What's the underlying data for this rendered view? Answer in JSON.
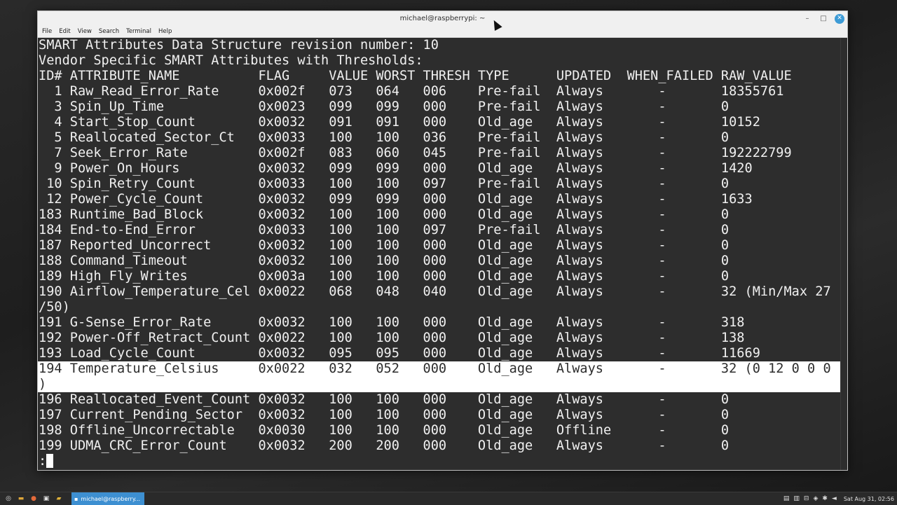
{
  "window": {
    "title": "michael@raspberrypi: ~",
    "controls": {
      "minimize": "–",
      "maximize": "□",
      "close": "✕"
    }
  },
  "menu": [
    "File",
    "Edit",
    "View",
    "Search",
    "Terminal",
    "Help"
  ],
  "terminal": {
    "lines": [
      "SMART Attributes Data Structure revision number: 10",
      "Vendor Specific SMART Attributes with Thresholds:",
      "ID# ATTRIBUTE_NAME          FLAG     VALUE WORST THRESH TYPE      UPDATED  WHEN_FAILED RAW_VALUE",
      "  1 Raw_Read_Error_Rate     0x002f   073   064   006    Pre-fail  Always       -       18355761",
      "  3 Spin_Up_Time            0x0023   099   099   000    Pre-fail  Always       -       0",
      "  4 Start_Stop_Count        0x0032   091   091   000    Old_age   Always       -       10152",
      "  5 Reallocated_Sector_Ct   0x0033   100   100   036    Pre-fail  Always       -       0",
      "  7 Seek_Error_Rate         0x002f   083   060   045    Pre-fail  Always       -       192222799",
      "  9 Power_On_Hours          0x0032   099   099   000    Old_age   Always       -       1420",
      " 10 Spin_Retry_Count        0x0033   100   100   097    Pre-fail  Always       -       0",
      " 12 Power_Cycle_Count       0x0032   099   099   000    Old_age   Always       -       1633",
      "183 Runtime_Bad_Block       0x0032   100   100   000    Old_age   Always       -       0",
      "184 End-to-End_Error        0x0033   100   100   097    Pre-fail  Always       -       0",
      "187 Reported_Uncorrect      0x0032   100   100   000    Old_age   Always       -       0",
      "188 Command_Timeout         0x0032   100   100   000    Old_age   Always       -       0",
      "189 High_Fly_Writes         0x003a   100   100   000    Old_age   Always       -       0",
      "190 Airflow_Temperature_Cel 0x0022   068   048   040    Old_age   Always       -       32 (Min/Max 27",
      "/50)",
      "191 G-Sense_Error_Rate      0x0032   100   100   000    Old_age   Always       -       318",
      "192 Power-Off_Retract_Count 0x0022   100   100   000    Old_age   Always       -       138",
      "193 Load_Cycle_Count        0x0032   095   095   000    Old_age   Always       -       11669",
      "194 Temperature_Celsius     0x0022   032   052   000    Old_age   Always       -       32 (0 12 0 0 0",
      ")",
      "196 Reallocated_Event_Count 0x0032   100   100   000    Old_age   Always       -       0",
      "197 Current_Pending_Sector  0x0032   100   100   000    Old_age   Always       -       0",
      "198 Offline_Uncorrectable   0x0030   100   100   000    Old_age   Offline      -       0",
      "199 UDMA_CRC_Error_Count    0x0032   200   200   000    Old_age   Always       -       0"
    ],
    "highlighted_lines": [
      21,
      22
    ],
    "prompt": ":"
  },
  "taskbar": {
    "task_label": "michael@raspberry...",
    "clock": "Sat Aug 31, 02:56",
    "launcher_icons": [
      "menu-icon",
      "files-icon",
      "browser-icon",
      "terminal-icon",
      "folder-icon"
    ],
    "tray_icons": [
      "clipboard-icon",
      "notes-icon",
      "network-icon",
      "shield-icon",
      "bluetooth-icon",
      "volume-icon"
    ]
  },
  "colors": {
    "terminal_bg": "#2d2d2d",
    "terminal_fg": "#f0f0f0",
    "highlight_bg": "#ffffff",
    "task_active": "#3d8fd1",
    "close_button": "#3d9bd6"
  }
}
